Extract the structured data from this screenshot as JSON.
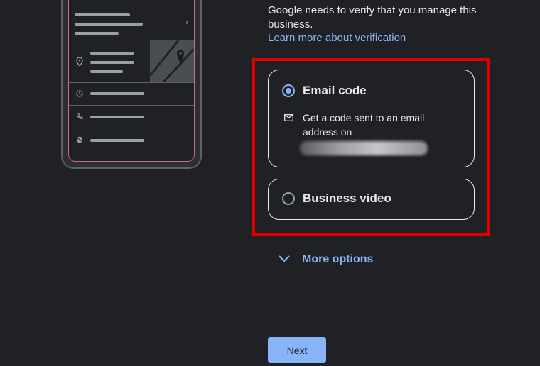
{
  "verification": {
    "description": "Google needs to verify that you manage this business.",
    "learn_more": "Learn more about verification"
  },
  "options": {
    "email": {
      "title": "Email code",
      "description": "Get a code sent to an email address on",
      "icon": "mail-icon",
      "selected": true
    },
    "video": {
      "title": "Business video",
      "selected": false
    }
  },
  "more_options": "More options",
  "next_label": "Next",
  "colors": {
    "background": "#202124",
    "accent": "#8ab4f8",
    "highlight": "#e00000"
  }
}
